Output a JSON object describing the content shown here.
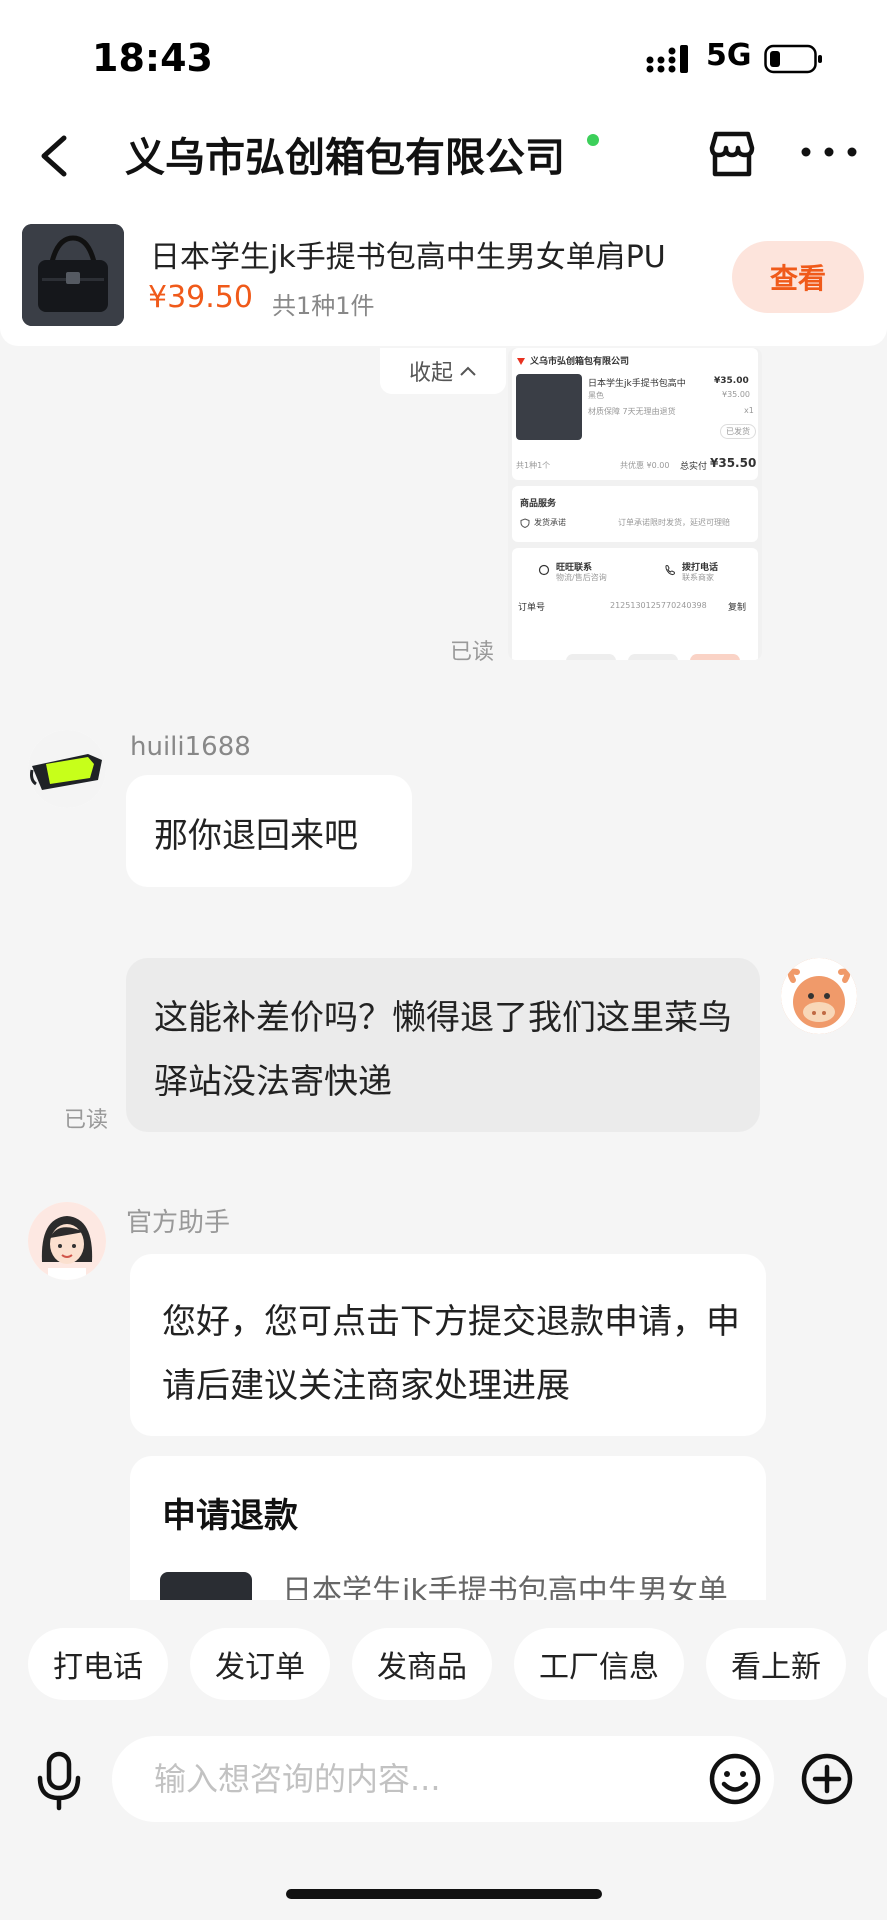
{
  "status_bar": {
    "time": "18:43",
    "network": "5G"
  },
  "header": {
    "title": "义乌市弘创箱包有限公司"
  },
  "product": {
    "title": "日本学生jk手提书包高中生男女单肩PU",
    "price": "¥39.50",
    "count": "共1种1件",
    "view_label": "查看"
  },
  "screenshot_message": {
    "collapse_label": "收起",
    "read_label": "已读",
    "shop_name": "义乌市弘创箱包有限公司",
    "item_title": "日本学生jk手提书包高中",
    "item_color": "黑色",
    "item_price_paid": "¥35.00",
    "item_price_orig": "¥35.00",
    "item_tags": "材质保障   7天无理由退货",
    "item_qty": "x1",
    "item_status": "已发货",
    "summary_count": "共1种1个",
    "summary_discount": "共优惠 ¥0.00",
    "summary_total_label": "总实付",
    "summary_total": "¥35.50",
    "service_title": "商品服务",
    "service_item": "发货承诺",
    "service_detail": "订单承诺限时发货，延迟可理赔",
    "contact_wangwang": "旺旺联系",
    "contact_wangwang_sub": "物流/售后咨询",
    "contact_phone": "拨打电话",
    "contact_phone_sub": "联系商家",
    "order_label": "订单号",
    "order_number": "2125130125770240398",
    "copy_label": "复制"
  },
  "seller_message": {
    "name": "huili1688",
    "text": "那你退回来吧"
  },
  "my_message": {
    "text": "这能补差价吗？懒得退了我们这里菜鸟驿站没法寄快递",
    "read_label": "已读"
  },
  "assistant_message": {
    "name": "官方助手",
    "text": "您好，您可点击下方提交退款申请，申请后建议关注商家处理进展",
    "card_title": "申请退款",
    "card_item_title": "日本学生jk手提书包高中生男女单"
  },
  "quick_actions": [
    "打电话",
    "发订单",
    "发商品",
    "工厂信息",
    "看上新"
  ],
  "input": {
    "placeholder": "输入想咨询的内容..."
  },
  "colors": {
    "accent": "#f05a1a",
    "accent_soft": "#fde4dc",
    "online": "#3ccf5a",
    "bubble_mine": "#ebebeb"
  }
}
